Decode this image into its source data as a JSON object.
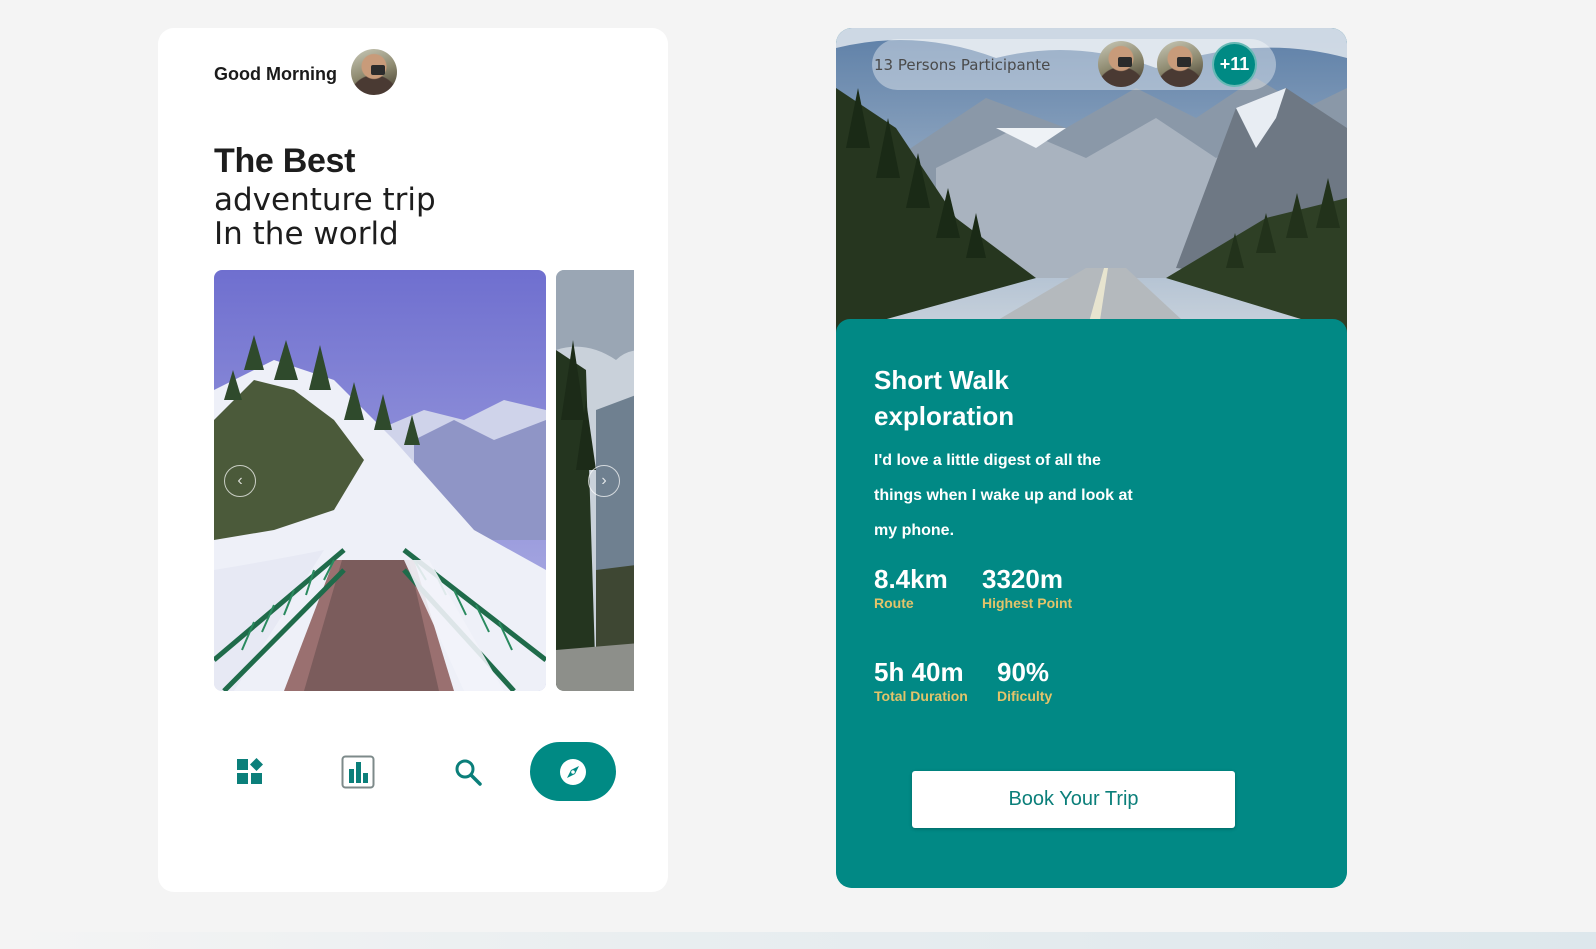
{
  "left_card": {
    "greeting": "Good Morning",
    "headline_1": "The Best",
    "headline_2": "adventure trip",
    "headline_3": "In the world",
    "carousel": {
      "prev_icon": "chevron-left-icon",
      "next_icon": "chevron-right-icon",
      "prev_glyph": "‹",
      "next_glyph": "›"
    },
    "nav": [
      {
        "icon": "dashboard-icon"
      },
      {
        "icon": "bar-chart-icon"
      },
      {
        "icon": "search-icon"
      },
      {
        "icon": "compass-icon",
        "active": true
      }
    ]
  },
  "right_card": {
    "participants_label": "13 Persons Participante",
    "participants_more": "+11",
    "title": "Short Walk exploration",
    "description": "I'd love a little digest of all the things when I wake up and look at my phone.",
    "stats": {
      "route_value": "8.4km",
      "route_label": "Route",
      "highest_value": "3320m",
      "highest_label": "Highest Point",
      "duration_value": "5h 40m",
      "duration_label": "Total Duration",
      "difficulty_value": "90%",
      "difficulty_label": "Dificulty"
    },
    "book_button": "Book Your Trip"
  },
  "colors": {
    "accent": "#018985",
    "stat_label": "#e3c36a",
    "background": "#f4f4f4"
  }
}
